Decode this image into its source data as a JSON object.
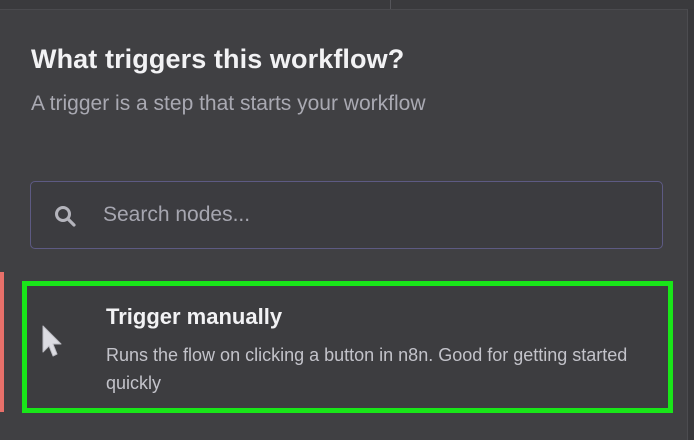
{
  "header": {
    "title": "What triggers this workflow?",
    "subtitle": "A trigger is a step that starts your workflow"
  },
  "search": {
    "icon": "search-icon",
    "placeholder": "Search nodes...",
    "value": ""
  },
  "nodes": [
    {
      "title": "Trigger manually",
      "description": "Runs the flow on clicking a button in n8n. Good for getting started quickly",
      "icon": "cursor-pointer-icon",
      "selected": true
    }
  ],
  "colors": {
    "background": "#404043",
    "highlight_border": "#19e619",
    "selected_accent": "#e8706a",
    "search_border": "#5d5a83"
  }
}
